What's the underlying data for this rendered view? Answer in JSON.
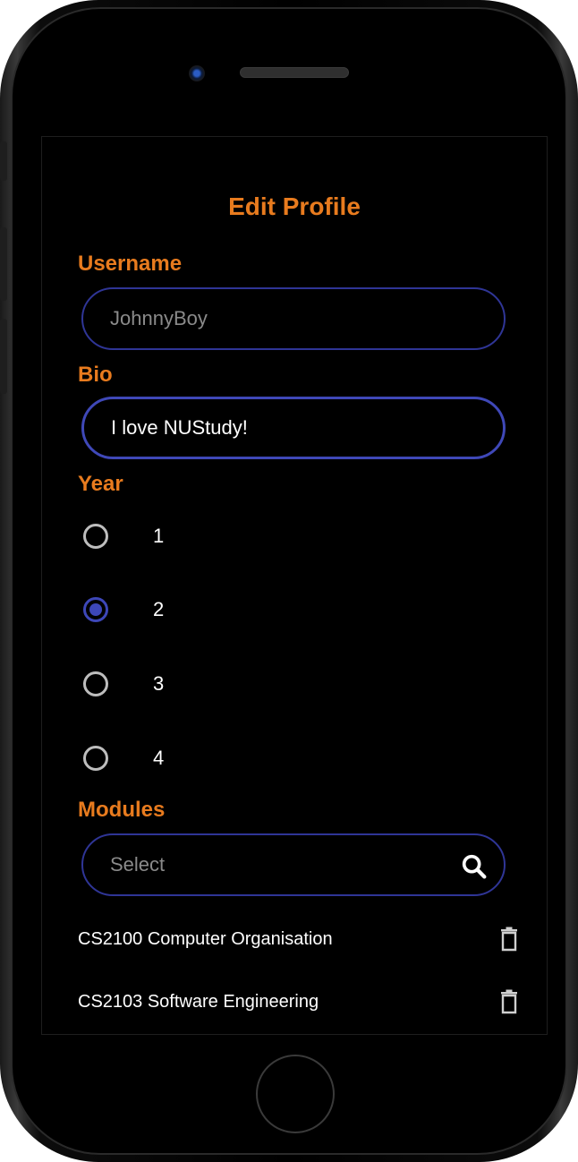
{
  "page": {
    "title": "Edit Profile"
  },
  "username": {
    "label": "Username",
    "placeholder": "JohnnyBoy",
    "value": ""
  },
  "bio": {
    "label": "Bio",
    "value": "I love NUStudy!"
  },
  "year": {
    "label": "Year",
    "options": [
      "1",
      "2",
      "3",
      "4"
    ],
    "selected": "2"
  },
  "modules": {
    "label": "Modules",
    "search_placeholder": "Select",
    "items": [
      {
        "name": "CS2100 Computer Organisation",
        "icon": "trash-icon"
      },
      {
        "name": "CS2103 Software Engineering",
        "icon": "trash-icon"
      }
    ]
  },
  "colors": {
    "accent": "#e87b1e",
    "input_border": "#2f3596",
    "radio_selected": "#3d47b8",
    "background": "#000000"
  },
  "icons": {
    "search": "search-icon",
    "delete": "trash-icon"
  }
}
